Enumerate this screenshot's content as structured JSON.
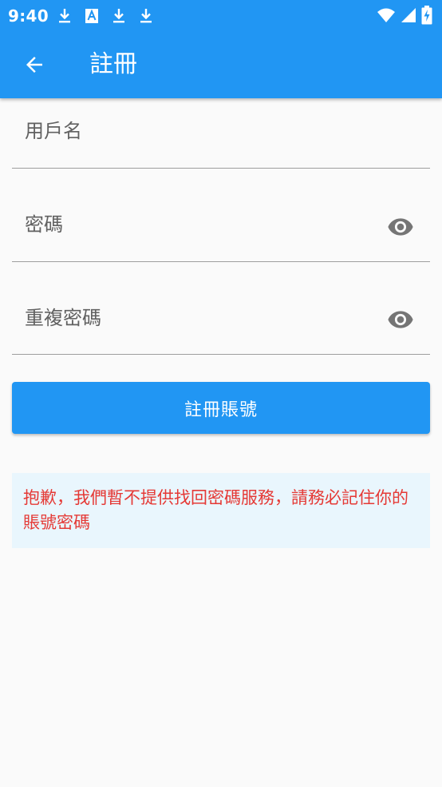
{
  "status_bar": {
    "time": "9:40",
    "left_icons": [
      "download-icon",
      "text-a-icon",
      "download-icon",
      "download-icon"
    ],
    "right_icons": [
      "wifi-icon",
      "signal-icon",
      "battery-charging-icon"
    ]
  },
  "app_bar": {
    "title": "註冊",
    "back_icon": "arrow-back-icon",
    "color": "#2196f3"
  },
  "form": {
    "username": {
      "label": "用戶名"
    },
    "password": {
      "label": "密碼",
      "toggle_icon": "eye-icon"
    },
    "confirm_password": {
      "label": "重複密碼",
      "toggle_icon": "eye-icon"
    }
  },
  "submit_button": {
    "label": "註冊賬號",
    "color": "#2196f3"
  },
  "notice": {
    "text": "抱歉，我們暫不提供找回密碼服務，請務必記住你的賬號密碼",
    "text_color": "#e53935",
    "background": "#e9f6fd"
  }
}
